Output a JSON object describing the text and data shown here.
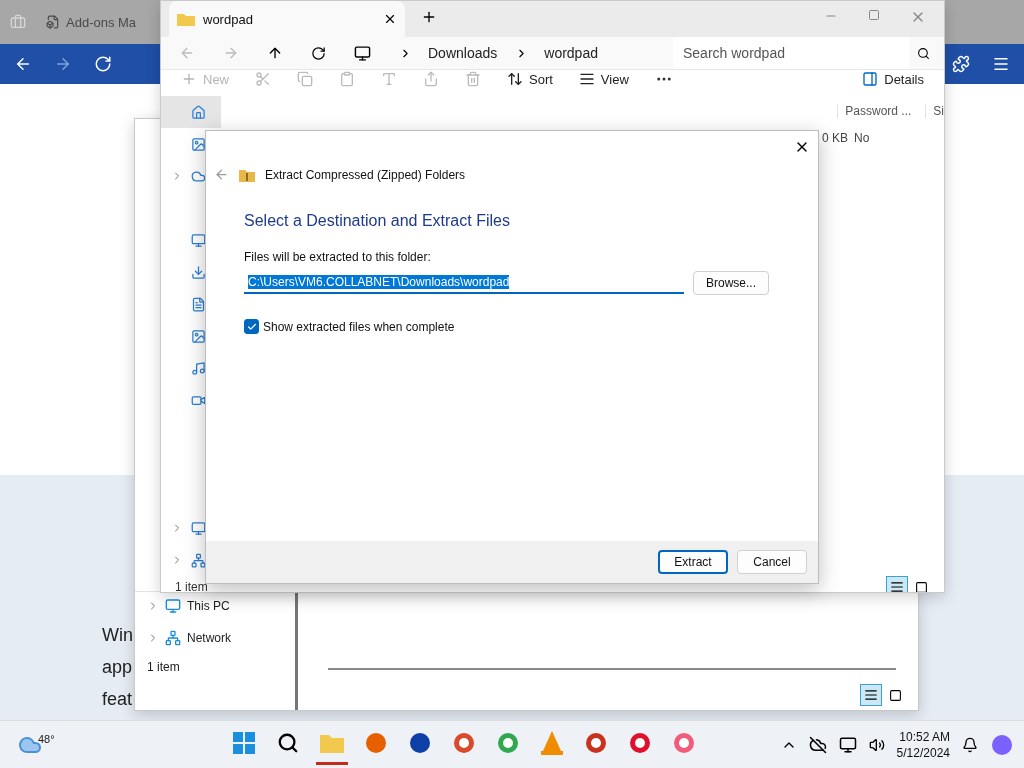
{
  "browser": {
    "tab_title": "Add-ons Ma",
    "page_lines": [
      "Win",
      "app",
      "feat"
    ]
  },
  "back_window": {
    "nav_items": [
      {
        "label": "This PC",
        "kind": "pc"
      },
      {
        "label": "Network",
        "kind": "network"
      }
    ],
    "status": "1 item",
    "view_buttons": [
      {
        "selected": true
      },
      {
        "selected": false
      }
    ]
  },
  "explorer": {
    "tab": "wordpad",
    "breadcrumb": [
      "Downloads",
      "wordpad"
    ],
    "search": {
      "placeholder": "Search wordpad"
    },
    "new_label": "New",
    "sort_label": "Sort",
    "view_label": "View",
    "details_label": "Details",
    "columns": [
      "Password ...",
      "Si"
    ],
    "row": [
      "0 KB",
      "No"
    ],
    "status": "1 item",
    "view_buttons": [
      {
        "selected": true
      },
      {
        "selected": false
      }
    ]
  },
  "dialog": {
    "title": "Extract Compressed (Zipped) Folders",
    "heading": "Select a Destination and Extract Files",
    "field_label": "Files will be extracted to this folder:",
    "path": "C:\\Users\\VM6.COLLABNET\\Downloads\\wordpad",
    "browse": "Browse...",
    "checkbox": {
      "label": "Show extracted files when complete",
      "checked": true
    },
    "buttons": [
      {
        "label": "Extract",
        "focused": true
      },
      {
        "label": "Cancel",
        "focused": false
      }
    ]
  },
  "taskbar": {
    "weather": "48°",
    "time": "10:52 AM",
    "date": "5/12/2024"
  }
}
